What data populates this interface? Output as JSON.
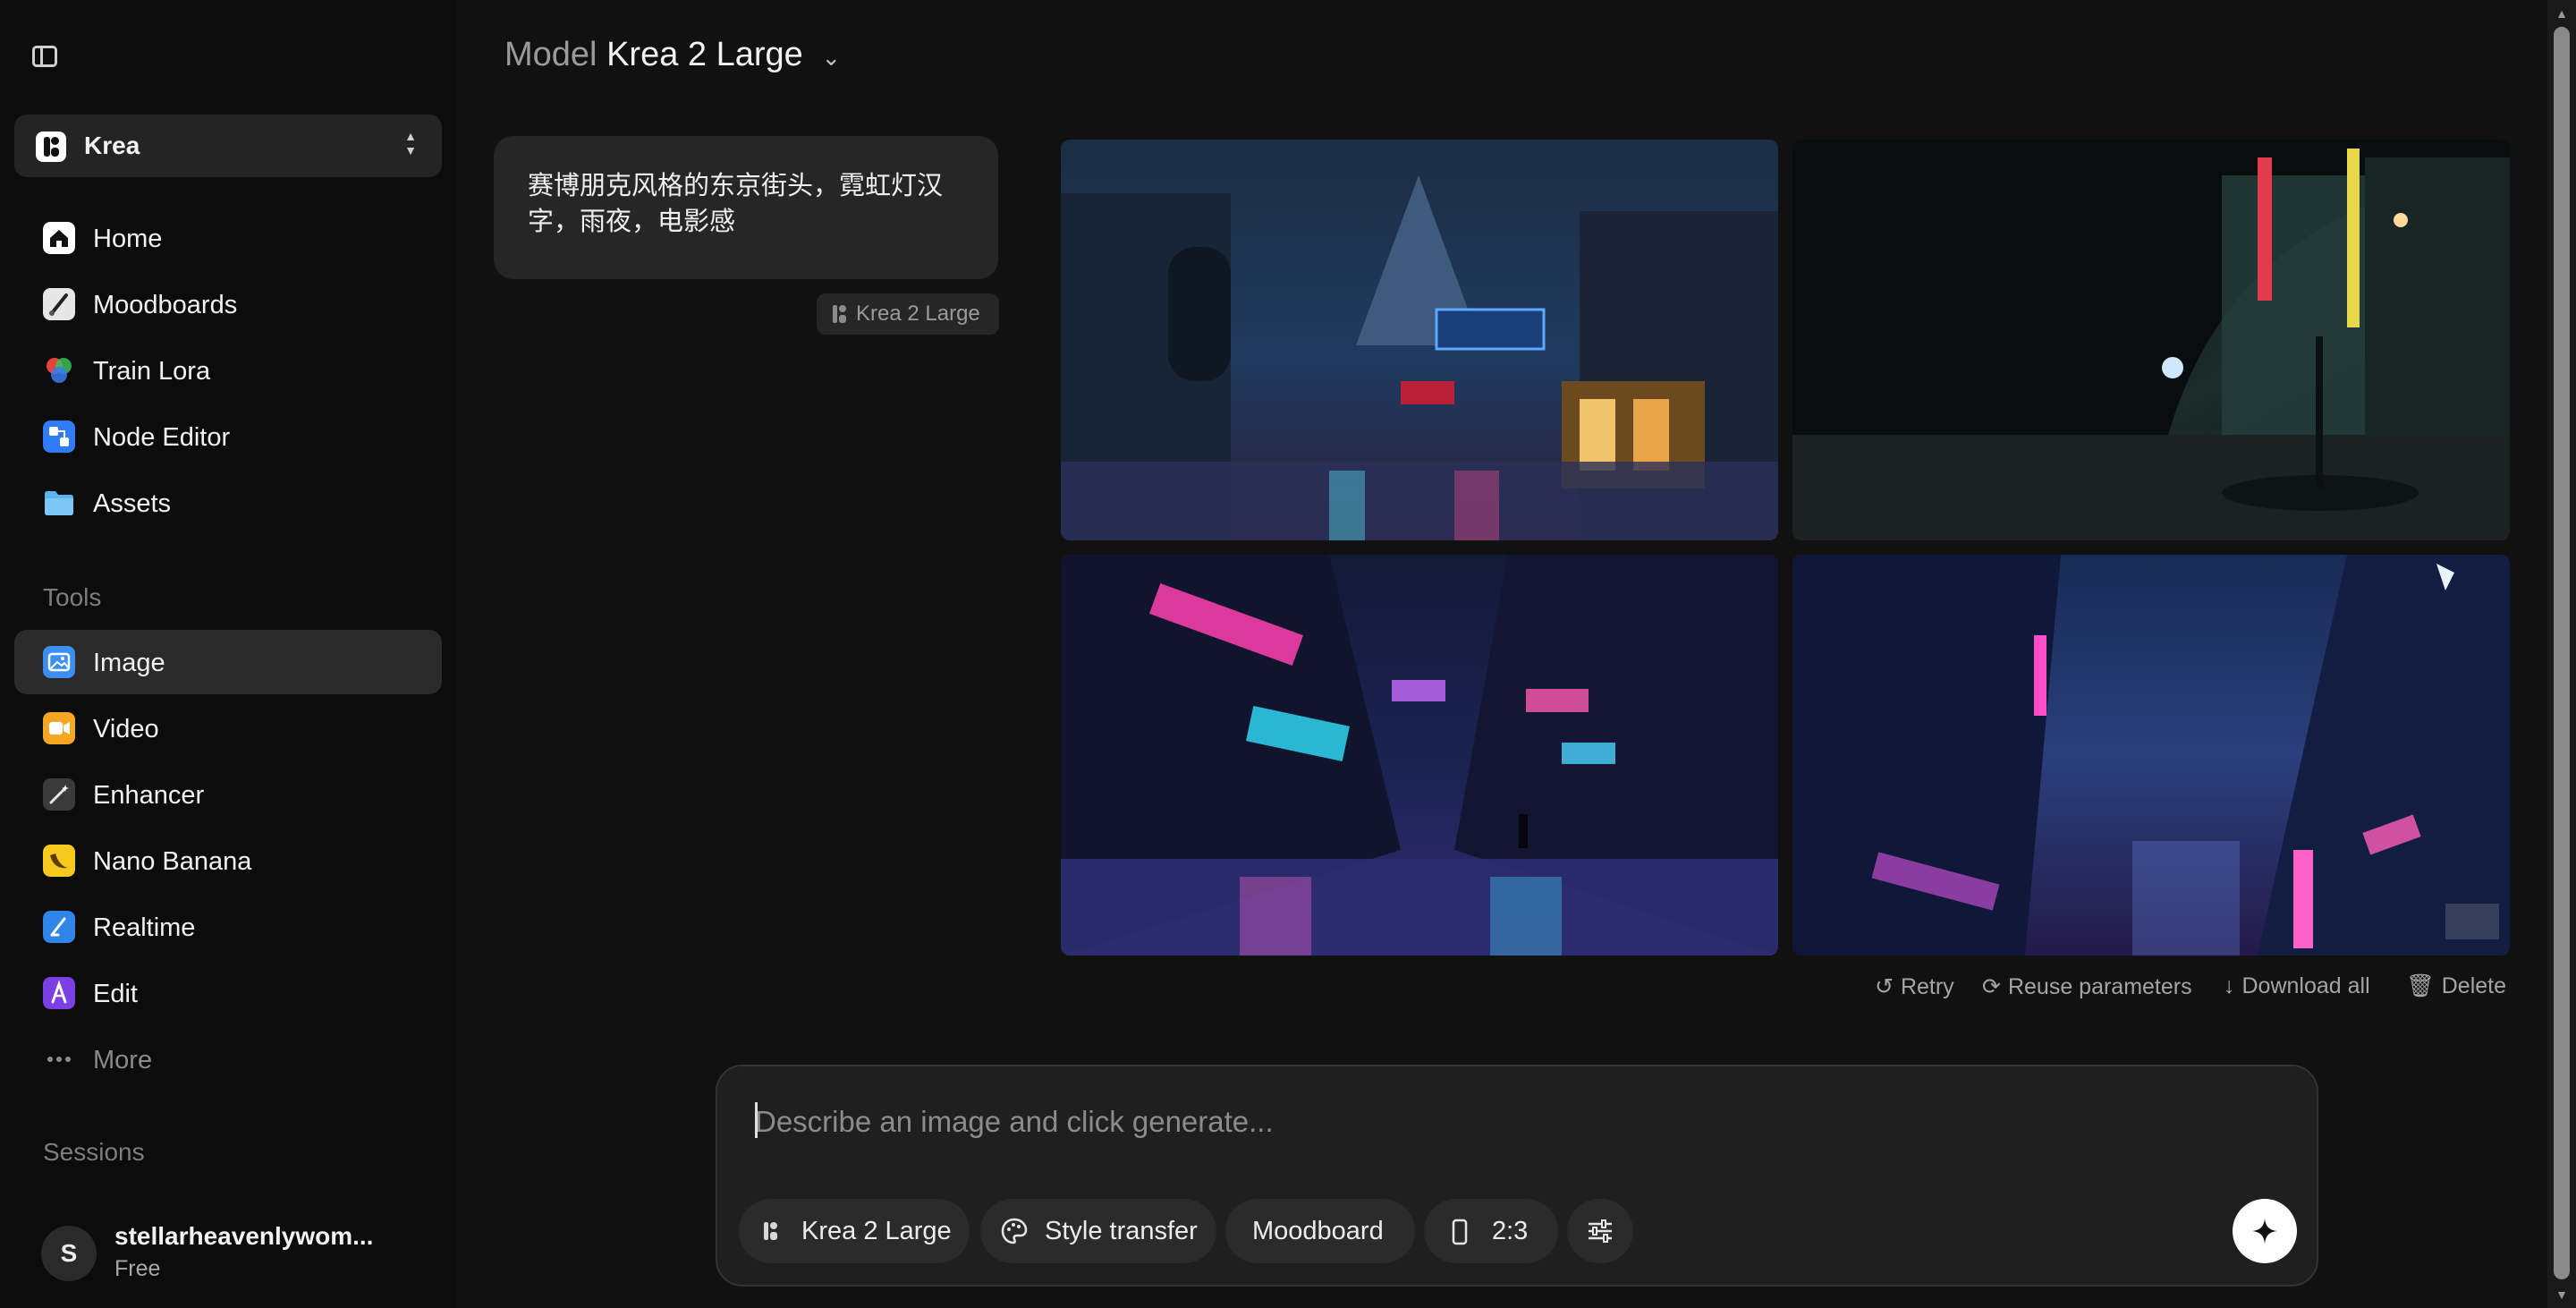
{
  "sidebar": {
    "workspace_name": "Krea",
    "nav_items": [
      {
        "label": "Home",
        "icon": "home-icon"
      },
      {
        "label": "Moodboards",
        "icon": "moodboard-icon"
      },
      {
        "label": "Train Lora",
        "icon": "train-lora-icon"
      },
      {
        "label": "Node Editor",
        "icon": "node-editor-icon"
      },
      {
        "label": "Assets",
        "icon": "folder-icon"
      }
    ],
    "tools_heading": "Tools",
    "tools": [
      {
        "label": "Image",
        "icon": "image-icon",
        "active": true
      },
      {
        "label": "Video",
        "icon": "video-icon"
      },
      {
        "label": "Enhancer",
        "icon": "enhancer-icon"
      },
      {
        "label": "Nano Banana",
        "icon": "banana-icon"
      },
      {
        "label": "Realtime",
        "icon": "realtime-icon"
      },
      {
        "label": "Edit",
        "icon": "edit-icon"
      }
    ],
    "more_label": "More",
    "sessions_heading": "Sessions",
    "user": {
      "initial": "S",
      "name": "stellarheavenlywom...",
      "plan": "Free"
    }
  },
  "header": {
    "model_label": "Model",
    "model_value": "Krea 2 Large"
  },
  "conversation": {
    "prompt_text": "赛博朋克风格的东京街头，霓虹灯汉字，雨夜，电影感",
    "model_tag": "Krea 2 Large",
    "images": [
      {
        "name": "generated-image-1"
      },
      {
        "name": "generated-image-2"
      },
      {
        "name": "generated-image-3"
      },
      {
        "name": "generated-image-4"
      }
    ],
    "actions": {
      "retry": "Retry",
      "reuse": "Reuse parameters",
      "download_all": "Download all",
      "delete": "Delete"
    }
  },
  "composer": {
    "placeholder": "Describe an image and click generate...",
    "model_pill": "Krea 2 Large",
    "style_transfer": "Style transfer",
    "moodboard": "Moodboard",
    "aspect_ratio": "2:3"
  },
  "colors": {
    "background": "#111111",
    "sidebar": "#0c0c0c",
    "active_item": "#2a2a2a",
    "accent_white": "#ffffff"
  }
}
